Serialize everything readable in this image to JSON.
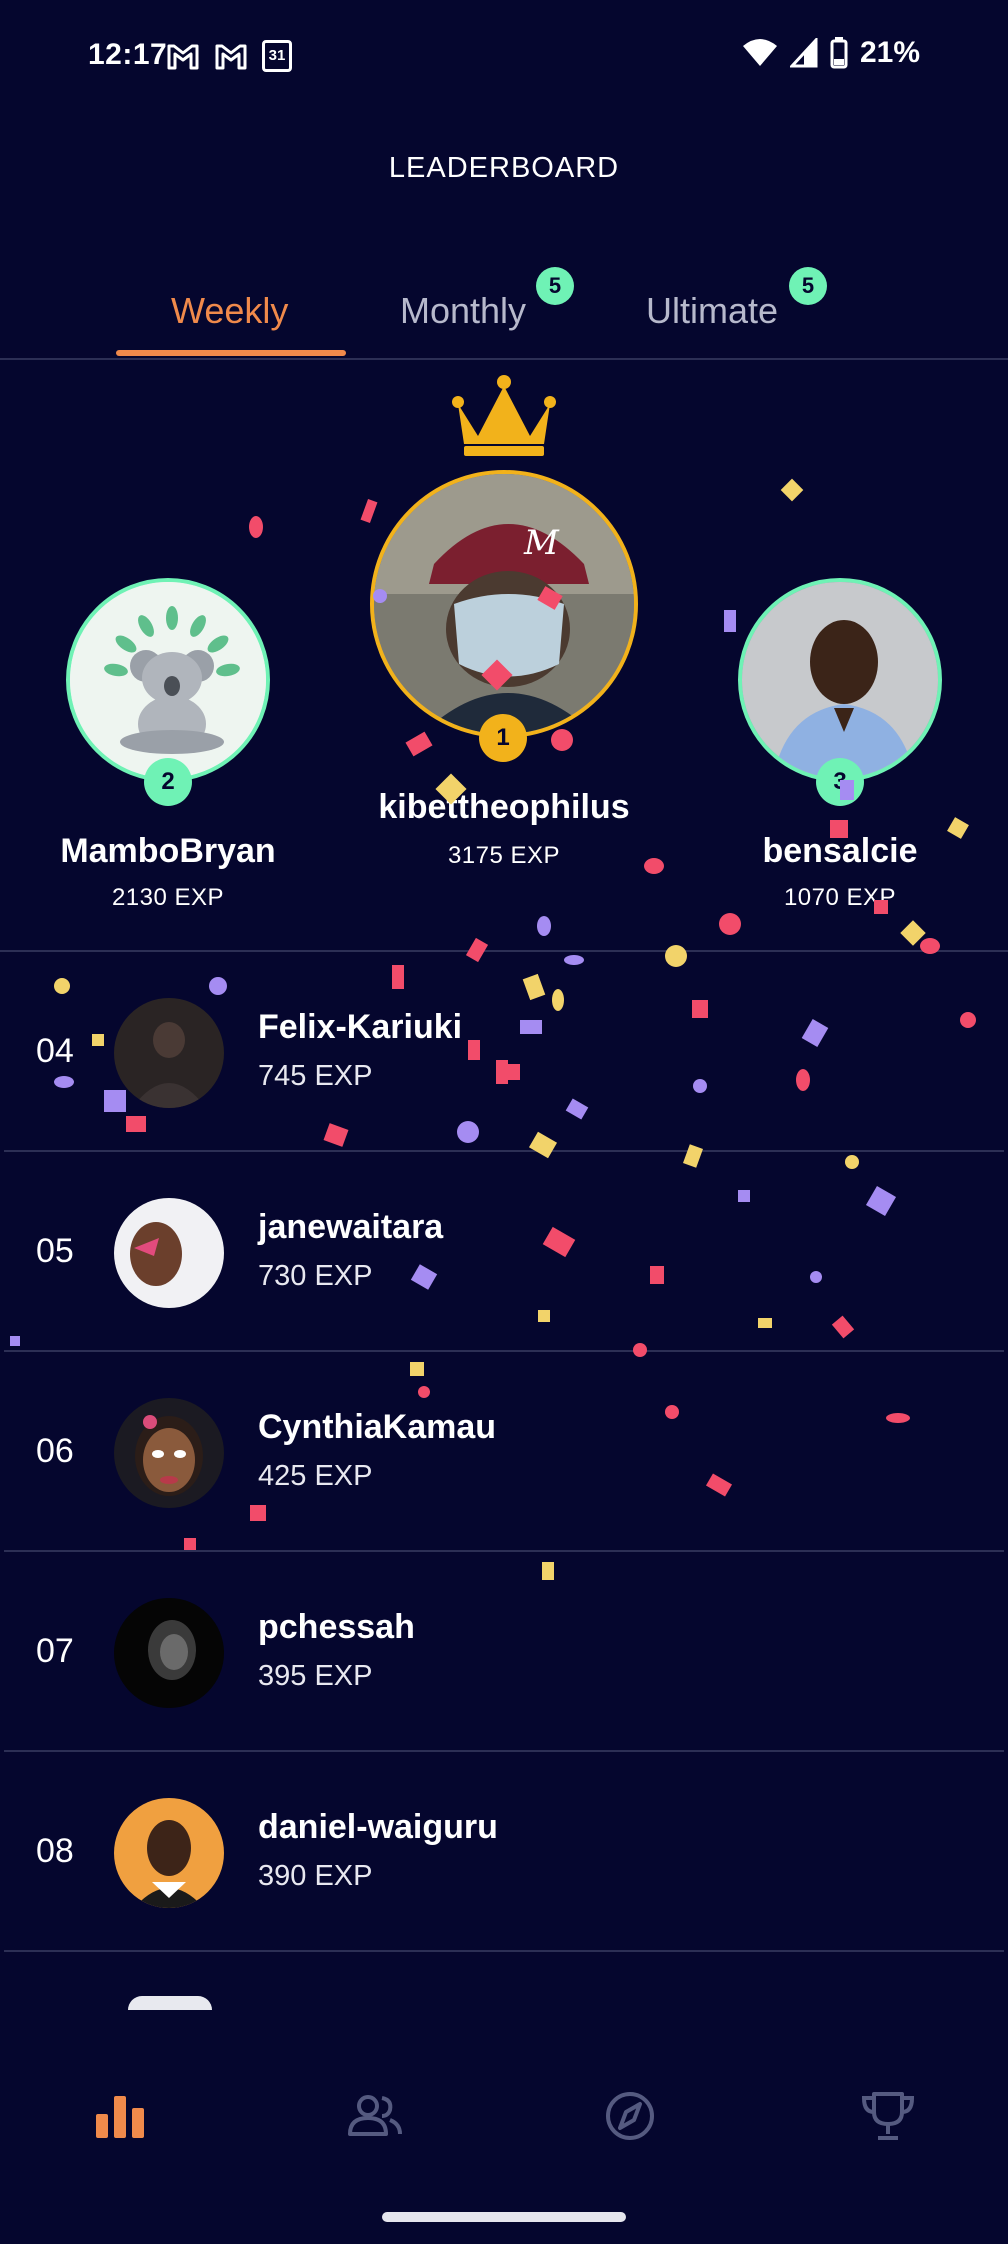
{
  "status_bar": {
    "time": "12:17",
    "battery": "21%",
    "calendar_day": "31",
    "left_icons": [
      "gmail-icon",
      "gmail-icon",
      "calendar-icon"
    ],
    "right_icons": [
      "wifi-icon",
      "cell-signal-icon",
      "battery-icon"
    ]
  },
  "header": {
    "title": "LEADERBOARD"
  },
  "tabs": [
    {
      "label": "Weekly",
      "active": true
    },
    {
      "label": "Monthly",
      "badge": "5"
    },
    {
      "label": "Ultimate",
      "badge": "5"
    }
  ],
  "podium": {
    "first": {
      "rank": "1",
      "name": "kibettheophilus",
      "exp": "3175 EXP"
    },
    "second": {
      "rank": "2",
      "name": "MamboBryan",
      "exp": "2130 EXP"
    },
    "third": {
      "rank": "3",
      "name": "bensalcie",
      "exp": "1070 EXP"
    }
  },
  "rows": [
    {
      "rank": "04",
      "name": "Felix-Kariuki",
      "exp": "745 EXP"
    },
    {
      "rank": "05",
      "name": "janewaitara",
      "exp": "730 EXP"
    },
    {
      "rank": "06",
      "name": "CynthiaKamau",
      "exp": "425 EXP"
    },
    {
      "rank": "07",
      "name": "pchessah",
      "exp": "395 EXP"
    },
    {
      "rank": "08",
      "name": "daniel-waiguru",
      "exp": "390 EXP"
    }
  ],
  "bottom_nav": [
    "leaderboard-icon",
    "people-icon",
    "compass-icon",
    "trophy-icon"
  ],
  "colors": {
    "background": "#05062e",
    "accent": "#f08a4b",
    "badge": "#6ff2b5",
    "gold": "#f2b21b"
  }
}
